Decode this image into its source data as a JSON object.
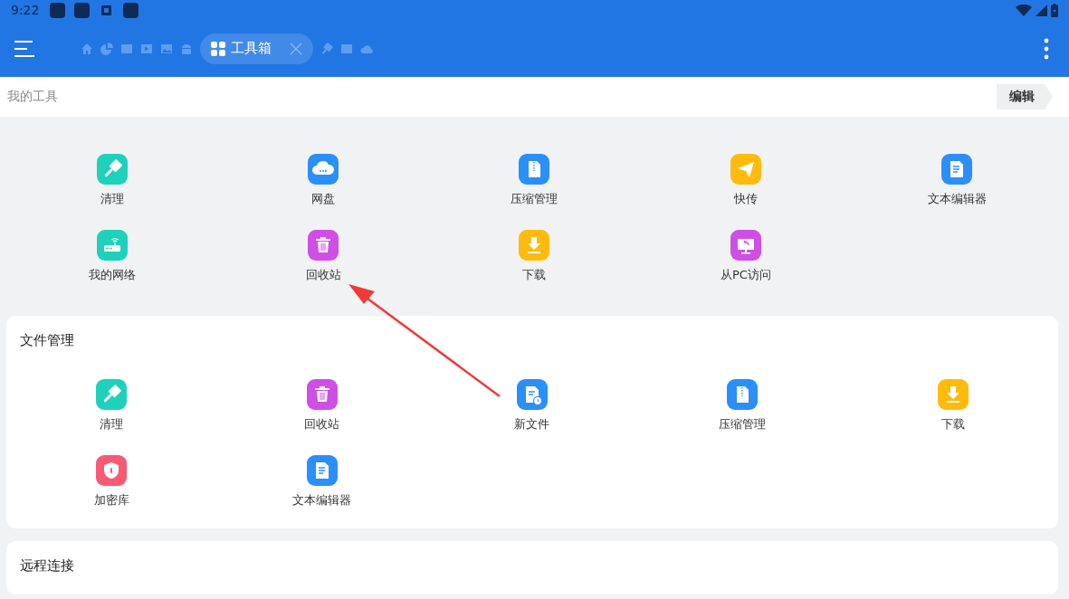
{
  "status_bar": {
    "time": "9:22",
    "notifications": [
      {
        "kind": "app"
      },
      {
        "kind": "app"
      },
      {
        "kind": "keyboard"
      },
      {
        "kind": "app"
      }
    ]
  },
  "toolbar": {
    "tabs": [
      {
        "kind": "home",
        "selected": false
      },
      {
        "kind": "chart",
        "selected": false
      },
      {
        "kind": "film",
        "selected": false
      },
      {
        "kind": "video",
        "selected": false
      },
      {
        "kind": "image",
        "selected": false
      },
      {
        "kind": "android",
        "selected": false
      },
      {
        "kind": "toolbox",
        "label": "工具箱",
        "selected": true
      },
      {
        "kind": "broom",
        "selected": false
      },
      {
        "kind": "film",
        "selected": false
      },
      {
        "kind": "cloud",
        "selected": false
      }
    ]
  },
  "my_tools": {
    "title": "我的工具",
    "edit_button": "编辑",
    "tools": [
      {
        "kind": "broom",
        "label": "清理"
      },
      {
        "kind": "cloud",
        "label": "网盘"
      },
      {
        "kind": "zip",
        "label": "压缩管理"
      },
      {
        "kind": "send",
        "label": "快传"
      },
      {
        "kind": "doc",
        "label": "文本编辑器"
      },
      {
        "kind": "router",
        "label": "我的网络"
      },
      {
        "kind": "trash",
        "label": "回收站"
      },
      {
        "kind": "download",
        "label": "下载"
      },
      {
        "kind": "monitor",
        "label": "从PC访问"
      }
    ]
  },
  "sections": [
    {
      "title": "文件管理",
      "tools": [
        {
          "kind": "broom",
          "label": "清理"
        },
        {
          "kind": "trash",
          "label": "回收站"
        },
        {
          "kind": "newfile",
          "label": "新文件"
        },
        {
          "kind": "zip",
          "label": "压缩管理"
        },
        {
          "kind": "download",
          "label": "下载"
        },
        {
          "kind": "shield",
          "label": "加密库"
        },
        {
          "kind": "doc",
          "label": "文本编辑器"
        }
      ]
    },
    {
      "title": "远程连接"
    }
  ]
}
